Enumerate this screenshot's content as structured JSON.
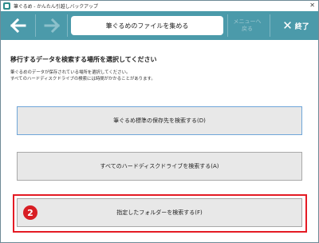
{
  "window": {
    "title": "筆ぐるめ - かんたん引越しバックアップ",
    "close_glyph": "✕"
  },
  "toolbar": {
    "step_title": "筆ぐるめのファイルを集める",
    "menu_back_line1": "メニューへ",
    "menu_back_line2": "戻る",
    "exit_label": "終了",
    "exit_glyph": "✕"
  },
  "content": {
    "heading": "移行するデータを検索する場所を選択してください",
    "desc_line1": "筆ぐるめのデータが保存されている場所を選択してください。",
    "desc_line2": "すべてのハードディスクドライブの検索には時間がかかることがあります。"
  },
  "actions": [
    {
      "label": "筆ぐるめ標準の保存先を検索する(D)"
    },
    {
      "label": "すべてのハードディスクドライブを検索する(A)"
    },
    {
      "label": "指定したフォルダーを検索する(F)"
    }
  ],
  "annotation": {
    "badge": "2",
    "color": "#e41b24"
  },
  "colors": {
    "toolbar": "#4b9aaa",
    "exit_text": "#ffffff",
    "disabled_text": "#9ec7d0"
  },
  "icons": [
    "app-icon",
    "back-arrow-icon",
    "forward-arrow-icon",
    "close-icon"
  ]
}
